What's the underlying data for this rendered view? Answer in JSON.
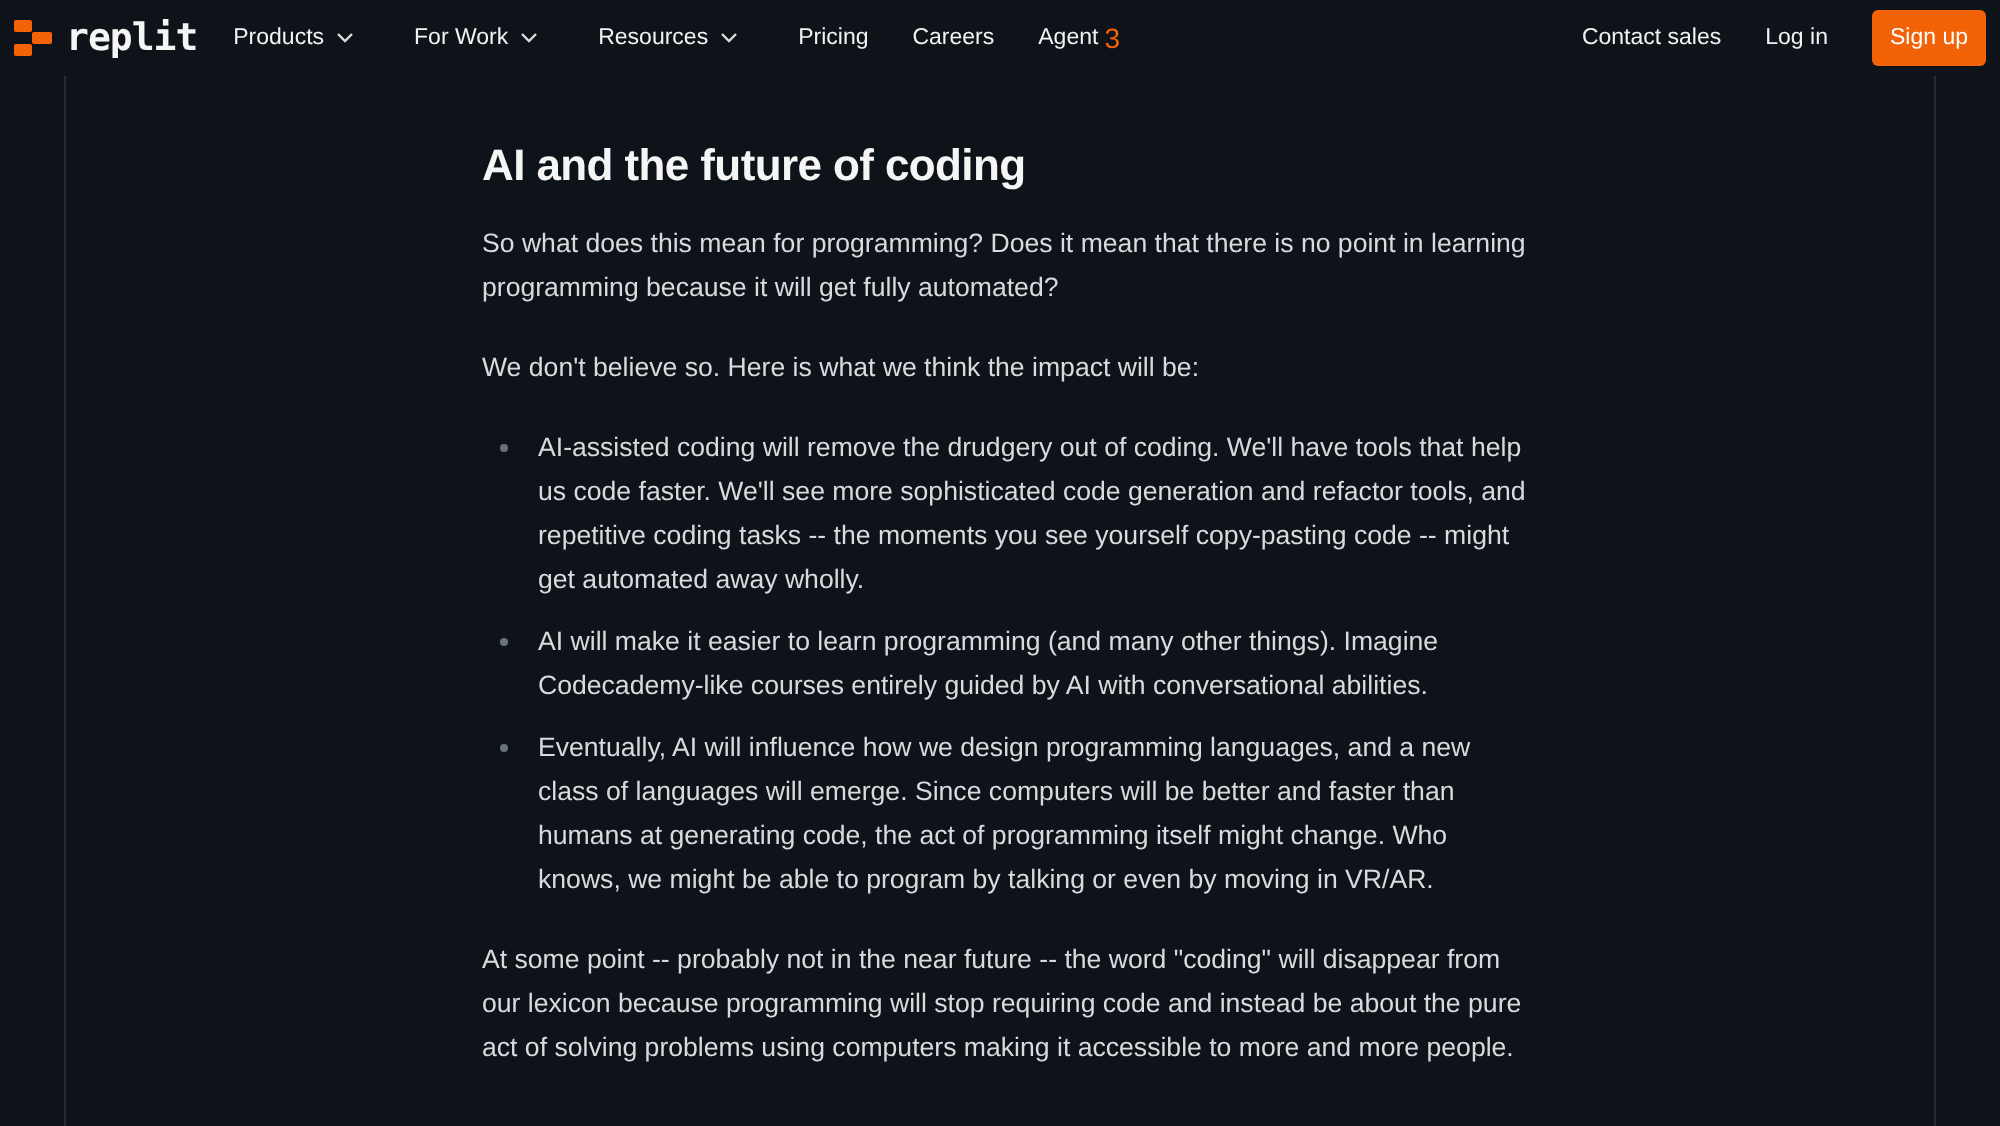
{
  "nav": {
    "logo": "replit",
    "items": [
      {
        "label": "Products",
        "caret": true
      },
      {
        "label": "For Work",
        "caret": true
      },
      {
        "label": "Resources",
        "caret": true
      },
      {
        "label": "Pricing",
        "caret": false
      },
      {
        "label": "Careers",
        "caret": false
      },
      {
        "label": "Agent",
        "caret": false,
        "badge": "3"
      }
    ],
    "actions": [
      {
        "label": "Contact sales",
        "kind": "link"
      },
      {
        "label": "Log in",
        "kind": "link"
      },
      {
        "label": "Sign up",
        "kind": "primary"
      }
    ]
  },
  "article": {
    "heading": "AI and the future of coding",
    "blocks": [
      {
        "kind": "paragraph",
        "text": "So what does this mean for programming? Does it mean that there is no point in learning programming because it will get fully automated?"
      },
      {
        "kind": "paragraph",
        "text": "We don't believe so. Here is what we think the impact will be:"
      },
      {
        "kind": "list",
        "items": [
          "AI-assisted coding will remove the drudgery out of coding. We'll have tools that help us code faster. We'll see more sophisticated code generation and refactor tools, and repetitive coding tasks -- the moments you see yourself copy-pasting code -- might get automated away wholly.",
          "AI will make it easier to learn programming (and many other things). Imagine Codecademy-like courses entirely guided by AI with conversational abilities.",
          "Eventually, AI will influence how we design programming languages, and a new class of languages will emerge. Since computers will be better and faster than humans at generating code, the act of programming itself might change. Who knows, we might be able to program by talking or even by moving in VR/AR."
        ]
      },
      {
        "kind": "paragraph",
        "text": "At some point -- probably not in the near future -- the word \"coding\" will disappear from our lexicon because programming will stop requiring code and instead be about the pure act of solving problems using computers making it accessible to more and more people."
      }
    ]
  }
}
